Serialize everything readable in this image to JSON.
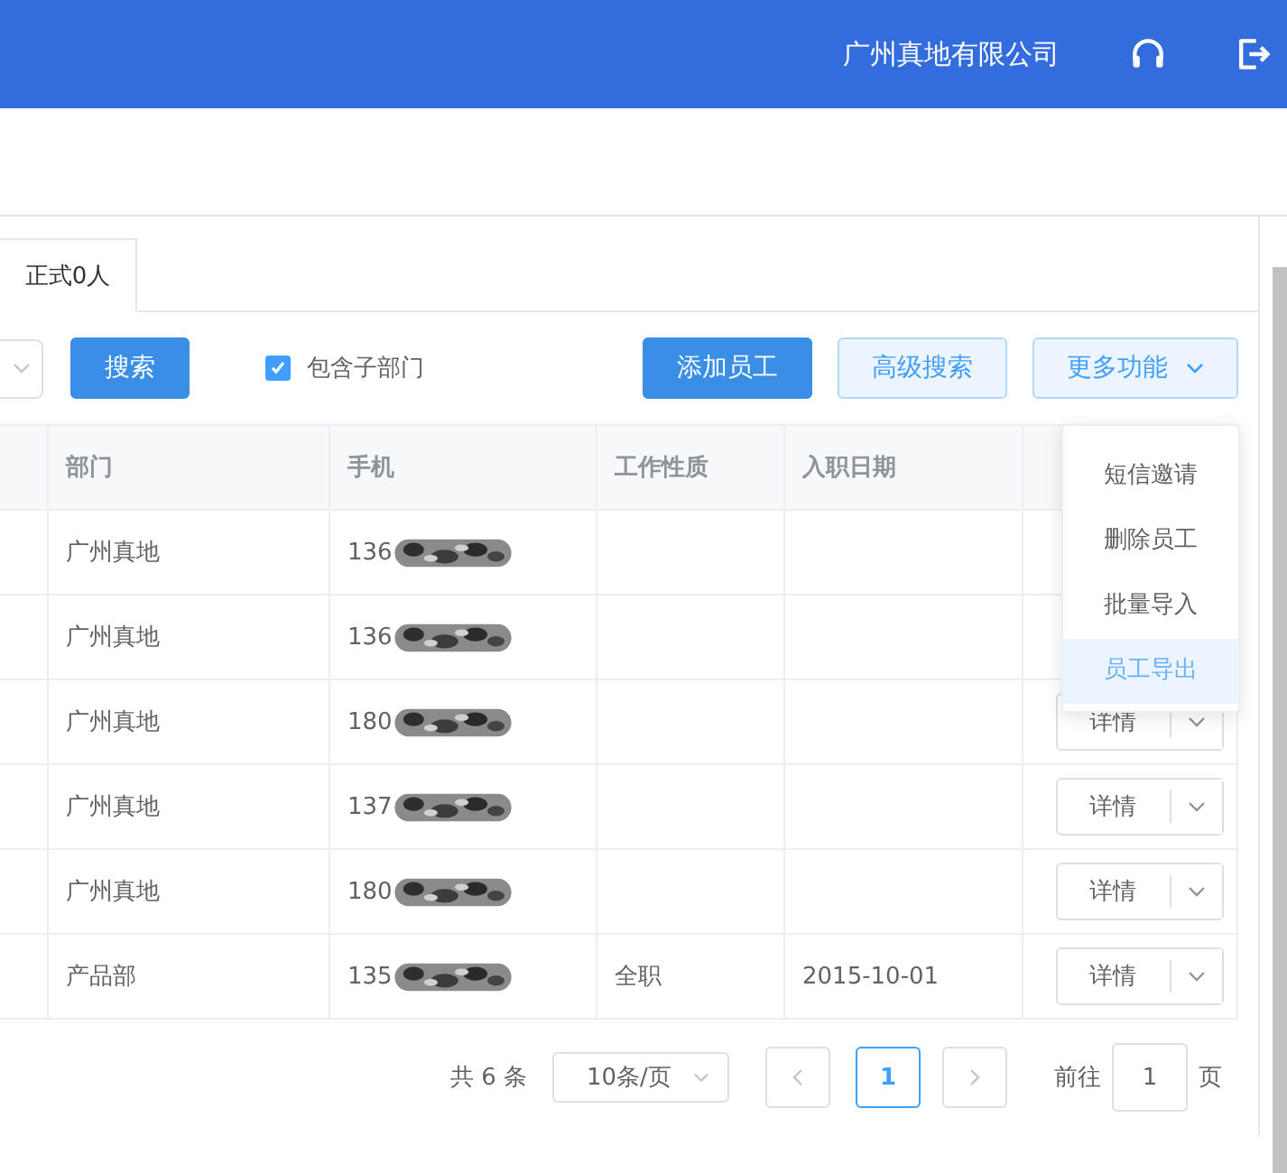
{
  "header": {
    "company": "广州真地有限公司"
  },
  "tabs": [
    {
      "label": "正式0人",
      "selected": true
    }
  ],
  "toolbar": {
    "search_button": "搜索",
    "include_subdepartments": {
      "label": "包含子部门",
      "checked": true
    },
    "buttons": [
      {
        "label": "添加员工",
        "kind": "primary"
      },
      {
        "label": "高级搜索",
        "kind": "plain"
      },
      {
        "label": "更多功能",
        "kind": "dropdown"
      }
    ]
  },
  "more_menu": {
    "items": [
      {
        "label": "短信邀请",
        "selected": false
      },
      {
        "label": "删除员工",
        "selected": false
      },
      {
        "label": "批量导入",
        "selected": false
      },
      {
        "label": "员工导出",
        "selected": true
      }
    ]
  },
  "table": {
    "columns": [
      "部门",
      "手机",
      "工作性质",
      "入职日期"
    ],
    "rows": [
      {
        "department": "广州真地",
        "phone": "136"
      },
      {
        "department": "广州真地",
        "phone": "136"
      },
      {
        "department": "广州真地",
        "phone": "180",
        "action": "详情"
      },
      {
        "department": "广州真地",
        "phone": "137",
        "action": "详情"
      },
      {
        "department": "广州真地",
        "phone": "180",
        "action": "详情"
      },
      {
        "department": "产品部",
        "phone": "135",
        "employment_type": "全职",
        "hire_date": "2015-10-01",
        "action": "详情"
      }
    ]
  },
  "pagination": {
    "total": "共 6 条",
    "page_size": "10条/页",
    "pages": [
      {
        "label": "1",
        "selected": true
      }
    ],
    "goto_label": "前往",
    "goto_value": "1",
    "goto_unit": "页"
  }
}
